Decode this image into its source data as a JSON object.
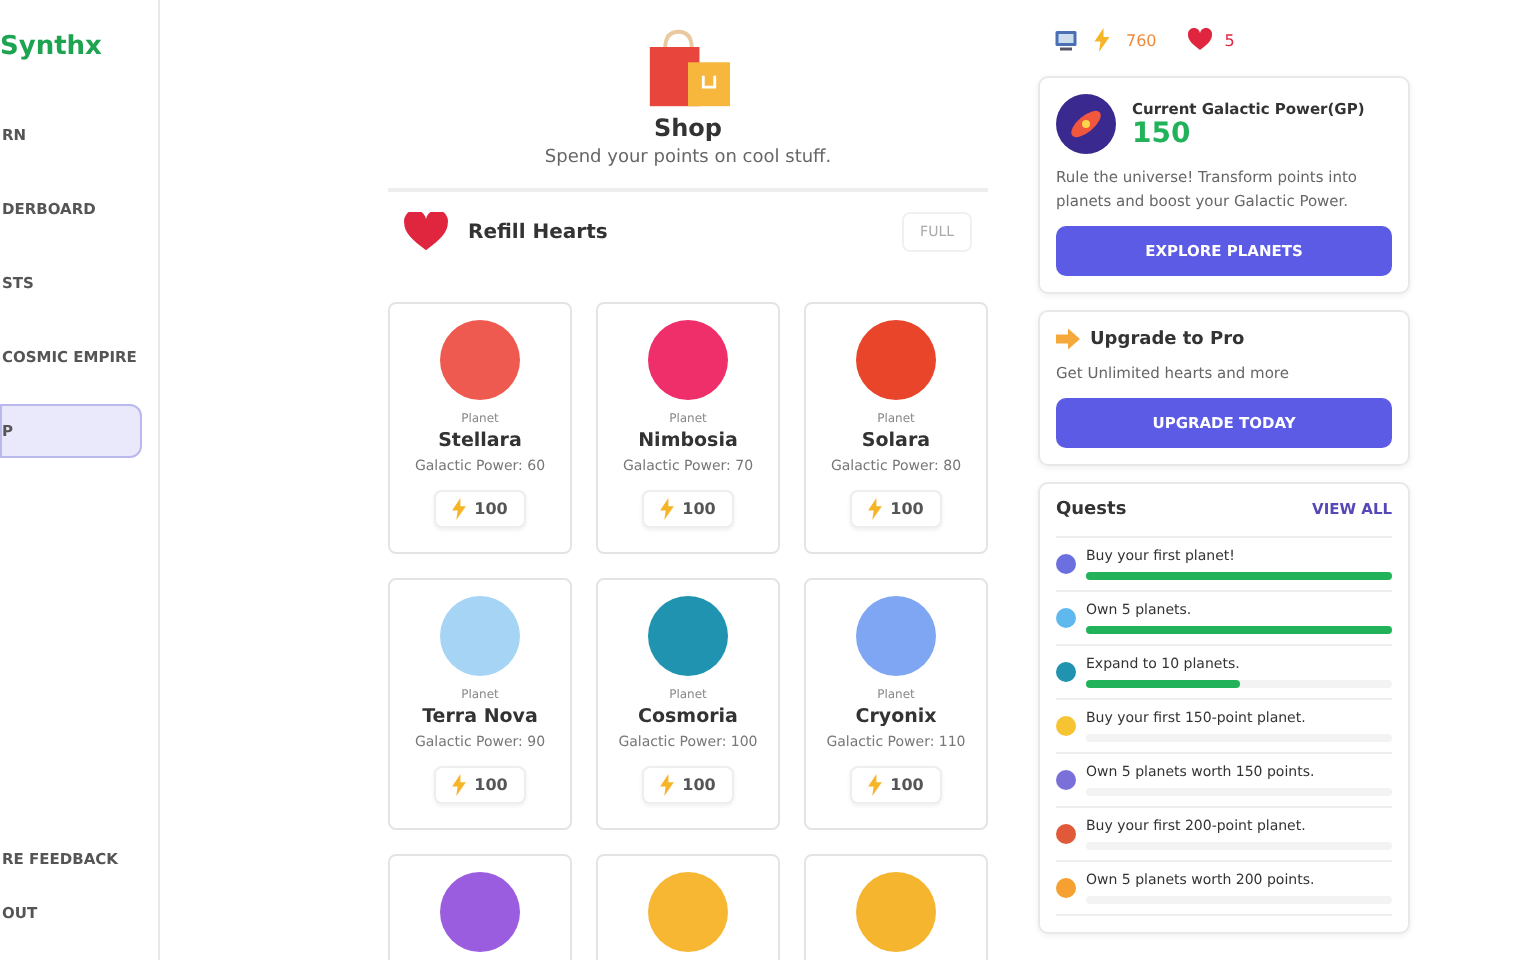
{
  "sidebar": {
    "logo": "Synthx",
    "items": [
      {
        "label": "RN",
        "selected": false
      },
      {
        "label": "DERBOARD",
        "selected": false
      },
      {
        "label": "STS",
        "selected": false
      },
      {
        "label": "COSMIC EMPIRE",
        "selected": false
      },
      {
        "label": "P",
        "selected": true
      }
    ],
    "bottom_items": [
      "RE FEEDBACK",
      "OUT"
    ]
  },
  "shop": {
    "title": "Shop",
    "subtitle": "Spend your points on cool stuff.",
    "refill": {
      "label": "Refill Hearts",
      "button": "FULL"
    },
    "planets": [
      {
        "type": "Planet",
        "name": "Stellara",
        "power": "Galactic Power: 60",
        "price": "100",
        "color": "#ef5a50"
      },
      {
        "type": "Planet",
        "name": "Nimbosia",
        "power": "Galactic Power: 70",
        "price": "100",
        "color": "#ee2f6a"
      },
      {
        "type": "Planet",
        "name": "Solara",
        "power": "Galactic Power: 80",
        "price": "100",
        "color": "#e8452a"
      },
      {
        "type": "Planet",
        "name": "Terra Nova",
        "power": "Galactic Power: 90",
        "price": "100",
        "color": "#a6d4f5"
      },
      {
        "type": "Planet",
        "name": "Cosmoria",
        "power": "Galactic Power: 100",
        "price": "100",
        "color": "#1f93b0"
      },
      {
        "type": "Planet",
        "name": "Cryonix",
        "power": "Galactic Power: 110",
        "price": "100",
        "color": "#7ea6f2"
      },
      {
        "color": "#9b5de0"
      },
      {
        "color": "#f7b733"
      },
      {
        "color": "#f6b52e"
      }
    ]
  },
  "stats": {
    "points": "760",
    "hearts": "5"
  },
  "power_card": {
    "title": "Current Galactic Power(GP)",
    "value": "150",
    "text": "Rule the universe! Transform points into planets and boost your Galactic Power.",
    "button": "EXPLORE PLANETS"
  },
  "pro_card": {
    "title": "Upgrade to Pro",
    "text": "Get Unlimited hearts and more",
    "button": "UPGRADE TODAY"
  },
  "quests": {
    "title": "Quests",
    "link": "VIEW ALL",
    "items": [
      {
        "label": "Buy your first planet!",
        "level": 1,
        "color": "#6b6fe0"
      },
      {
        "label": "Own 5 planets.",
        "level": 1,
        "color": "#5fb8ee"
      },
      {
        "label": "Expand to 10 planets.",
        "level": 0.5,
        "color": "#1f93b0"
      },
      {
        "label": "Buy your first 150-point planet.",
        "level": 0,
        "color": "#f6c333"
      },
      {
        "label": "Own 5 planets worth 150 points.",
        "level": 0,
        "color": "#7b6fd9"
      },
      {
        "label": "Buy your first 200-point planet.",
        "level": 0,
        "color": "#e05a3a"
      },
      {
        "label": "Own 5 planets worth 200 points.",
        "level": 0,
        "color": "#f5a030"
      }
    ]
  }
}
